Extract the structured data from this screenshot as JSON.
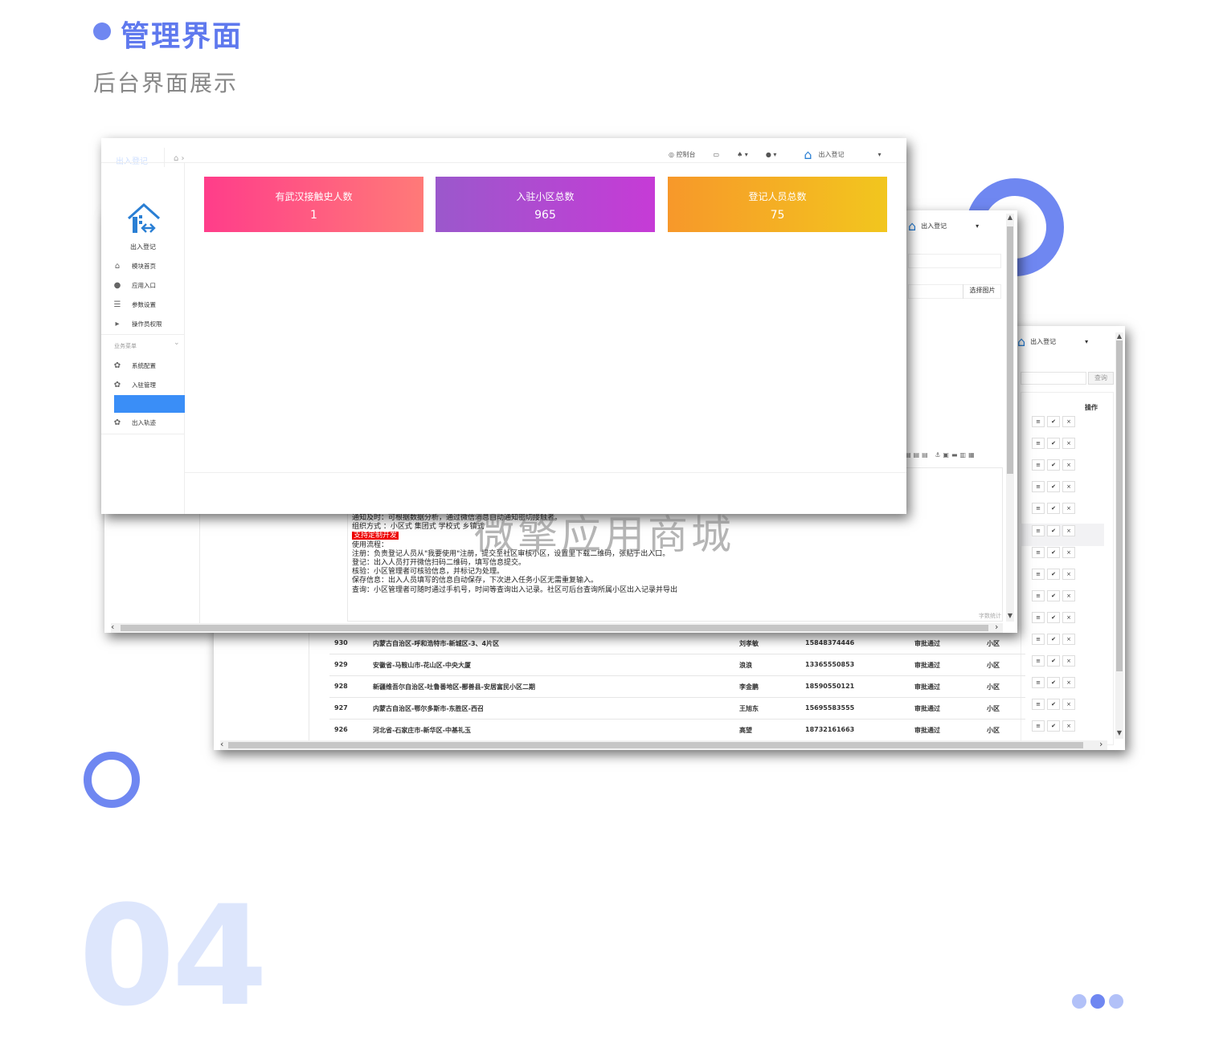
{
  "header": {
    "title": "管理界面",
    "subtitle": "后台界面展示"
  },
  "big_number": "04",
  "watermark": "微擎应用商城",
  "app": {
    "brand_name": "出入登记",
    "account_name": "出入登记",
    "console_label": "控制台"
  },
  "sidebar": {
    "items_top": [
      {
        "label": "模块首页",
        "icon": "home-icon"
      },
      {
        "label": "应用入口",
        "icon": "chat-icon"
      },
      {
        "label": "参数设置",
        "icon": "list-icon"
      },
      {
        "label": "操作员权限",
        "icon": "export-icon"
      }
    ],
    "section_label": "业务菜单",
    "items_biz": [
      {
        "label": "系统配置",
        "icon": "gear-icon"
      },
      {
        "label": "入驻管理",
        "icon": "gear-icon"
      },
      {
        "label": "",
        "icon": ""
      },
      {
        "label": "出入轨迹",
        "icon": "gear-icon"
      }
    ]
  },
  "cards": [
    {
      "label": "有武汉接触史人数",
      "value": "1"
    },
    {
      "label": "入驻小区总数",
      "value": "965"
    },
    {
      "label": "登记人员总数",
      "value": "75"
    }
  ],
  "editor": {
    "pick_image_label": "选择图片",
    "word_count_label": "字数统计",
    "lines": [
      "通知及时：可根据数据分析，通过微信消息自动通知密切接触者。",
      "组织方式 ：小区式 集团式 学校式 乡镇式",
      "支持定制开发",
      "使用流程：",
      "注册：负责登记人员从\"我要使用\"注册，提交至社区审核小区，设置里下载二维码，张贴于出入口。",
      "登记：出入人员打开微信扫码二维码，填写信息提交。",
      "核验：小区管理者可核验信息，并标记为处理。",
      "保存信息：出入人员填写的信息自动保存，下次进入任务小区无需重复输入。",
      "查询：小区管理者可随时通过手机号，时间等查询出入记录。社区可后台查询所属小区出入记录并导出"
    ]
  },
  "table": {
    "query_label": "查询",
    "op_header": "操作",
    "rows": [
      {
        "id": "930",
        "address": "内蒙古自治区-呼和浩特市-新城区-3、4片区",
        "name": "刘孝敏",
        "phone": "15848374446",
        "status": "审批通过",
        "type": "小区"
      },
      {
        "id": "929",
        "address": "安徽省-马鞍山市-花山区-中央大厦",
        "name": "浪浪",
        "phone": "13365550853",
        "status": "审批通过",
        "type": "小区"
      },
      {
        "id": "928",
        "address": "新疆维吾尔自治区-吐鲁番地区-鄯善县-安居富民小区二期",
        "name": "李金鹏",
        "phone": "18590550121",
        "status": "审批通过",
        "type": "小区"
      },
      {
        "id": "927",
        "address": "内蒙古自治区-鄂尔多斯市-东胜区-西召",
        "name": "王旭东",
        "phone": "15695583555",
        "status": "审批通过",
        "type": "小区"
      },
      {
        "id": "926",
        "address": "河北省-石家庄市-新华区-中基礼玉",
        "name": "高望",
        "phone": "18732161663",
        "status": "审批通过",
        "type": "小区"
      }
    ],
    "op_buttons": [
      "≡",
      "✔",
      "×"
    ]
  },
  "colors": {
    "accent": "#6f87f1",
    "active_nav": "#3a8ef7"
  }
}
